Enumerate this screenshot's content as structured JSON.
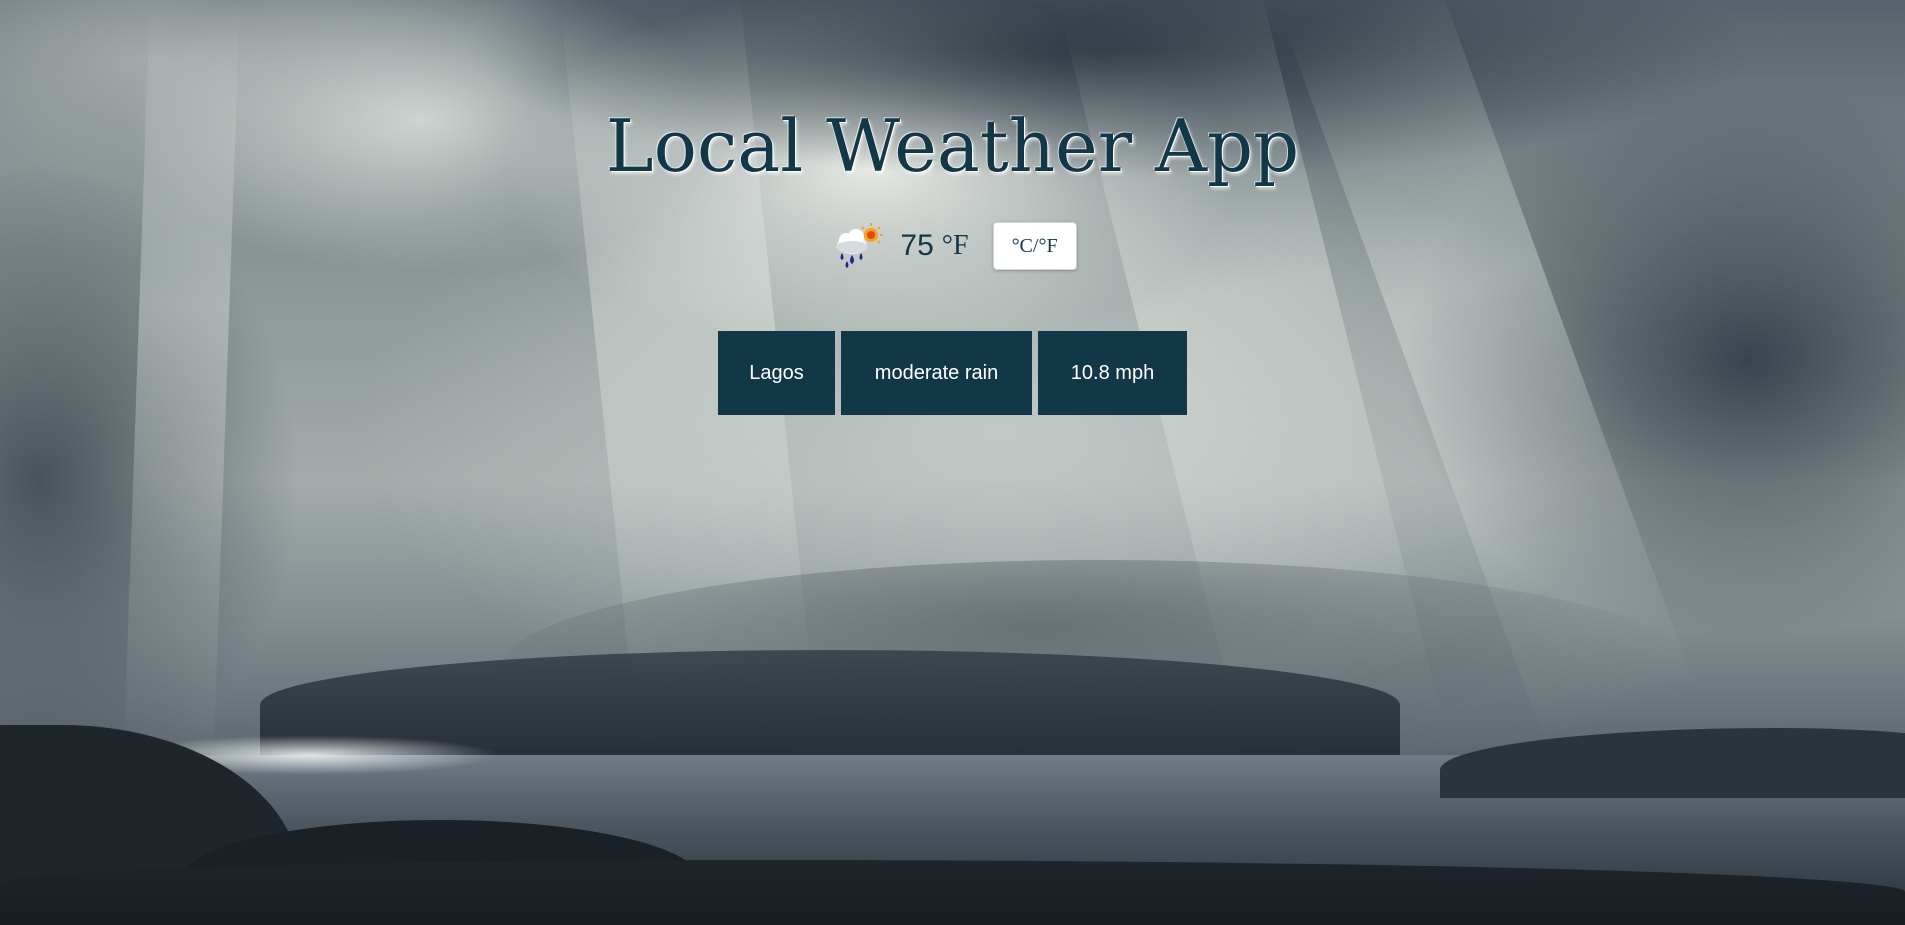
{
  "app": {
    "title": "Local Weather App"
  },
  "current": {
    "icon": "rain-cloud-with-sun-icon",
    "temperature": "75",
    "unit": "°F",
    "toggle_label": "°C/°F"
  },
  "details": {
    "city": "Lagos",
    "description": "moderate rain",
    "wind": "10.8 mph"
  },
  "colors": {
    "accent": "#123847",
    "box_text": "#ffffff",
    "toggle_background": "#ffffff"
  }
}
